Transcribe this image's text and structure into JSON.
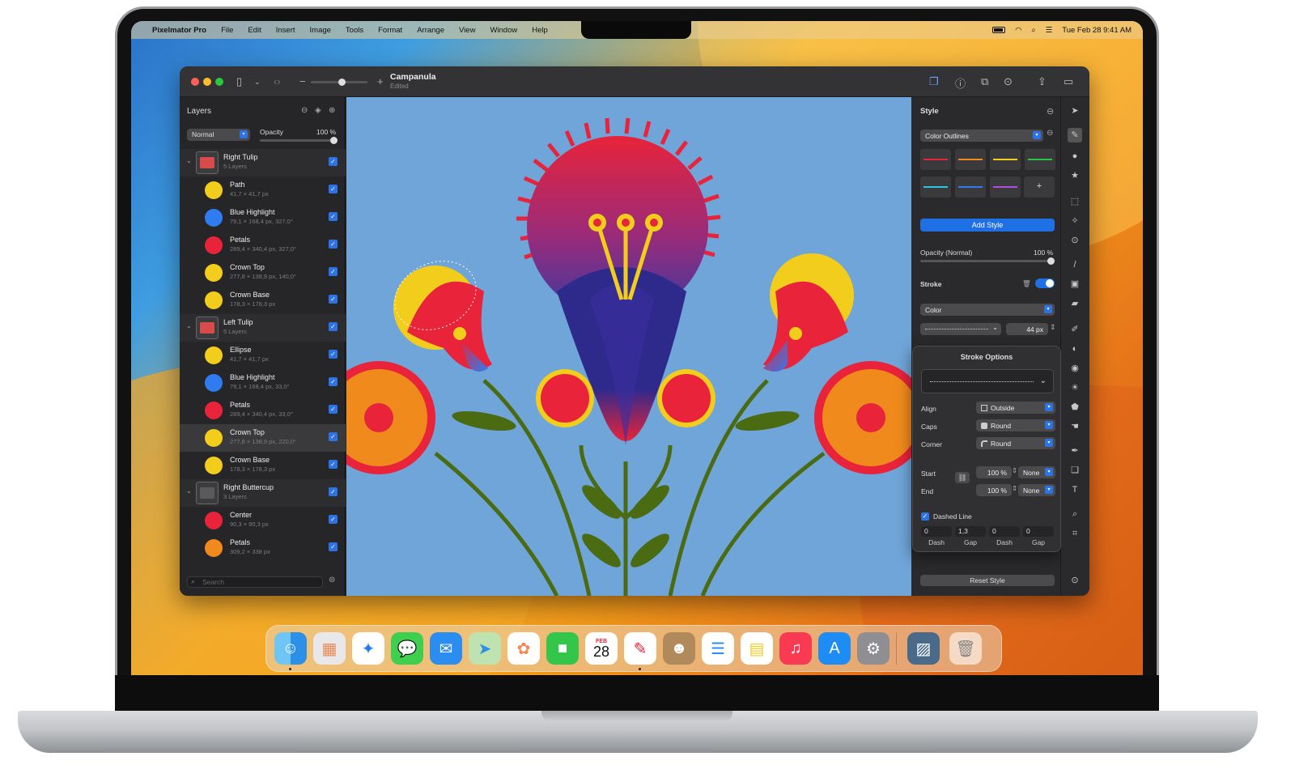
{
  "menubar": {
    "app_name": "Pixelmator Pro",
    "menus": [
      "File",
      "Edit",
      "Insert",
      "Image",
      "Tools",
      "Format",
      "Arrange",
      "View",
      "Window",
      "Help"
    ],
    "clock": "Tue Feb 28  9:41 AM"
  },
  "window": {
    "doc_title": "Campanula",
    "doc_status": "Edited"
  },
  "layers_panel": {
    "title": "Layers",
    "blend_mode": "Normal",
    "opacity_label": "Opacity",
    "opacity_value": "100 %",
    "search_placeholder": "Search",
    "rows": [
      {
        "name": "Right Tulip",
        "dim": "5 Layers",
        "group": true
      },
      {
        "name": "Path",
        "dim": "41,7 × 41,7 px"
      },
      {
        "name": "Blue Highlight",
        "dim": "79,1 × 168,4 px, 327,0°"
      },
      {
        "name": "Petals",
        "dim": "289,4 × 340,4 px, 327,0°"
      },
      {
        "name": "Crown Top",
        "dim": "277,8 × 138,9 px, 140,0°"
      },
      {
        "name": "Crown Base",
        "dim": "178,3 × 178,3 px"
      },
      {
        "name": "Left Tulip",
        "dim": "5 Layers",
        "group": true
      },
      {
        "name": "Ellipse",
        "dim": "41,7 × 41,7 px"
      },
      {
        "name": "Blue Highlight",
        "dim": "79,1 × 168,4 px, 33,0°"
      },
      {
        "name": "Petals",
        "dim": "289,4 × 340,4 px, 33,0°"
      },
      {
        "name": "Crown Top",
        "dim": "277,8 × 138,9 px, 220,0°"
      },
      {
        "name": "Crown Base",
        "dim": "178,3 × 178,3 px"
      },
      {
        "name": "Right Buttercup",
        "dim": "3 Layers",
        "group": true
      },
      {
        "name": "Center",
        "dim": "90,3 × 90,3 px"
      },
      {
        "name": "Petals",
        "dim": "309,2 × 338 px"
      }
    ]
  },
  "style_panel": {
    "title": "Style",
    "preset": "Color Outlines",
    "swatch_colors": [
      "#e8233a",
      "#f08a1c",
      "#f2cd1c",
      "#2bc24a",
      "#2ec6e8",
      "#2f7bf0",
      "#b04ee0"
    ],
    "add_swatch": "+",
    "add_style": "Add Style",
    "opacity_label": "Opacity (Normal)",
    "opacity_value": "100 %",
    "stroke_label": "Stroke",
    "fill_type": "Color",
    "stroke_width": "44 px",
    "reset": "Reset Style"
  },
  "stroke_options": {
    "title": "Stroke Options",
    "align_label": "Align",
    "align_value": "Outside",
    "caps_label": "Caps",
    "caps_value": "Round",
    "corner_label": "Corner",
    "corner_value": "Round",
    "start_label": "Start",
    "start_pct": "100 %",
    "start_value": "None",
    "end_label": "End",
    "end_pct": "100 %",
    "end_value": "None",
    "dashed_label": "Dashed Line",
    "dash_values": [
      "0",
      "1,3",
      "0",
      "0"
    ],
    "dash_labels": [
      "Dash",
      "Gap",
      "Dash",
      "Gap"
    ]
  },
  "dock": {
    "calendar_month": "FEB",
    "calendar_day": "28",
    "apps": [
      "finder-icon",
      "launchpad-icon",
      "safari-icon",
      "messages-icon",
      "mail-icon",
      "maps-icon",
      "photos-icon",
      "facetime-icon",
      "calendar-icon",
      "pixelmator-icon",
      "contacts-icon",
      "reminders-icon",
      "notes-icon",
      "music-icon",
      "app-store-icon",
      "system-settings-icon",
      "preview-icon",
      "trash-icon"
    ]
  }
}
